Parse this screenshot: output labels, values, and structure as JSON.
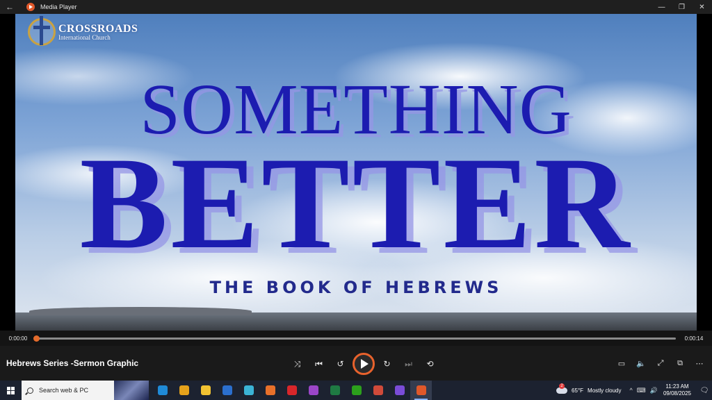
{
  "window": {
    "title": "Media Player",
    "back_icon": "back-arrow-icon",
    "controls": {
      "minimize": "—",
      "maximize": "❐",
      "close": "✕"
    }
  },
  "video": {
    "logo": {
      "name": "CROSSROADS",
      "subtitle": "International Church"
    },
    "headline_1": "SOMETHING",
    "headline_2": "BETTER",
    "tagline": "THE BOOK OF HEBREWS"
  },
  "seek": {
    "current_time": "0:00:00",
    "total_time": "0:00:14",
    "progress_fraction": 0.0,
    "accent": "#e46b2b"
  },
  "controls": {
    "media_title": "Hebrews Series -Sermon Graphic",
    "buttons": {
      "shuffle": "⤨",
      "previous": "⏮",
      "rewind": "↺",
      "forward": "↻",
      "next": "⏭",
      "repeat": "⟲",
      "captions": "▭",
      "volume": "🔈",
      "fullscreen": "⤢",
      "miniplayer": "⧉",
      "more": "⋯"
    }
  },
  "taskbar": {
    "search_placeholder": "Search web & PC",
    "apps": [
      {
        "name": "edge",
        "color": "#1f8ad8"
      },
      {
        "name": "chrome",
        "color": "#e5a21b"
      },
      {
        "name": "file-explorer",
        "color": "#f1c232"
      },
      {
        "name": "outlook",
        "color": "#2b6fce"
      },
      {
        "name": "notes",
        "color": "#3bb3d6"
      },
      {
        "name": "office",
        "color": "#e8702a"
      },
      {
        "name": "acrobat",
        "color": "#d8262a"
      },
      {
        "name": "app-purple",
        "color": "#9b46c8"
      },
      {
        "name": "excel",
        "color": "#1f7a43"
      },
      {
        "name": "quickbooks",
        "color": "#2ca01c"
      },
      {
        "name": "chrome-profile",
        "color": "#d04a3a"
      },
      {
        "name": "clipchamp",
        "color": "#7a4cd8"
      },
      {
        "name": "media-player",
        "color": "#e0582a"
      }
    ],
    "weather": {
      "badge": "2",
      "temp": "65°F",
      "condition": "Mostly cloudy"
    },
    "tray_icons": [
      "^",
      "⌨",
      "🔊"
    ],
    "time": "11:23 AM",
    "date": "09/08/2025",
    "notifications": "🗨"
  }
}
